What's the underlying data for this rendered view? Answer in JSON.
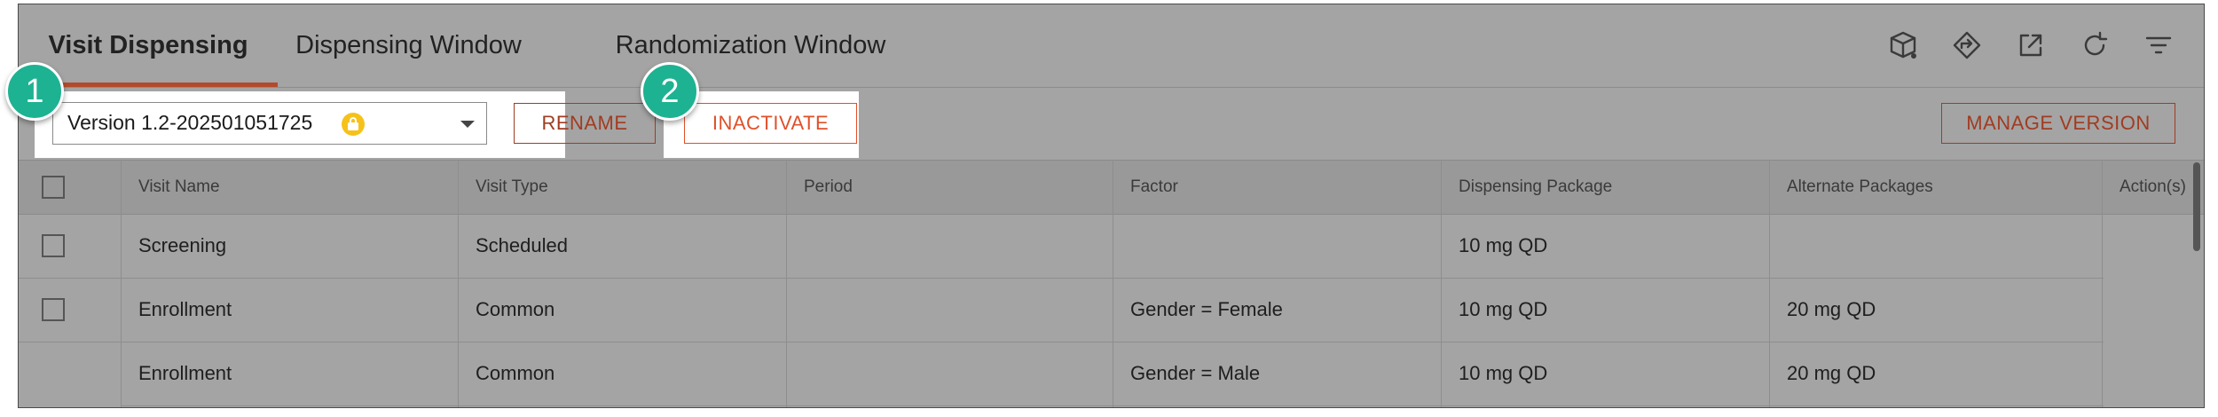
{
  "tabs": [
    {
      "label": "Visit Dispensing",
      "active": true
    },
    {
      "label": "Dispensing Window",
      "active": false
    },
    {
      "label": "Randomization Window",
      "active": false
    }
  ],
  "toolbar_icons": [
    "package-icon",
    "diamond-arrow-icon",
    "open-external-icon",
    "refresh-icon",
    "filter-icon"
  ],
  "version_select": {
    "value": "Version 1.2-202501051725",
    "locked": true
  },
  "buttons": {
    "rename": "RENAME",
    "inactivate": "INACTIVATE",
    "manage_version": "MANAGE VERSION"
  },
  "badges": {
    "one": "1",
    "two": "2"
  },
  "table": {
    "columns": [
      "Visit Name",
      "Visit Type",
      "Period",
      "Factor",
      "Dispensing Package",
      "Alternate Packages",
      "Action(s)"
    ],
    "rows": [
      {
        "visit_name": "Screening",
        "visit_type": "Scheduled",
        "period": "",
        "factor": "",
        "dispensing_package": "10 mg QD",
        "alternate_packages": "",
        "checkbox": true
      },
      {
        "visit_name": "Enrollment",
        "visit_type": "Common",
        "period": "",
        "factor": "Gender = Female",
        "dispensing_package": "10 mg QD",
        "alternate_packages": "20 mg QD",
        "checkbox": true
      },
      {
        "visit_name": "Enrollment",
        "visit_type": "Common",
        "period": "",
        "factor": "Gender = Male",
        "dispensing_package": "10 mg QD",
        "alternate_packages": "20 mg QD",
        "checkbox": false
      }
    ]
  },
  "colors": {
    "accent": "#b34a2b",
    "badge": "#1db292",
    "lock": "#f6c21a",
    "overlay": "#a4a4a4"
  }
}
